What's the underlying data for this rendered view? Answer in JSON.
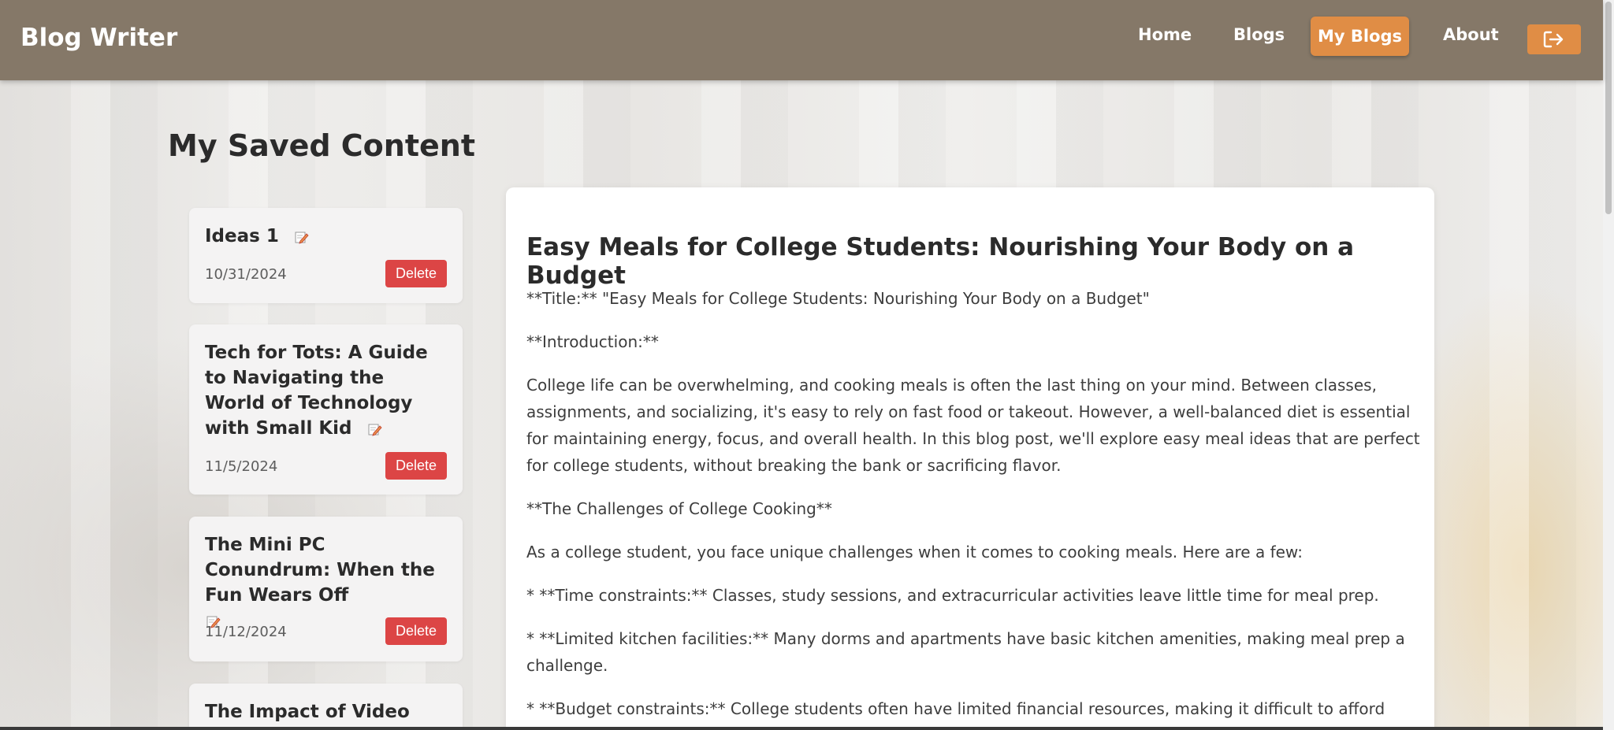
{
  "navbar": {
    "brand": "Blog Writer",
    "links": [
      "Home",
      "Blogs",
      "My Blogs",
      "About"
    ],
    "active_link": "My Blogs",
    "logout_icon": "logout-icon"
  },
  "page": {
    "title": "My Saved Content"
  },
  "saved_items": [
    {
      "title": "Ideas 1",
      "date": "10/31/2024",
      "delete_label": "Delete"
    },
    {
      "title": "Tech for Tots: A Guide to Navigating the World of Technology with Small Kid",
      "date": "11/5/2024",
      "delete_label": "Delete"
    },
    {
      "title": "The Mini PC Conundrum: When the Fun Wears Off",
      "date": "11/12/2024",
      "delete_label": "Delete"
    },
    {
      "title": "The Impact of Video",
      "date": "",
      "delete_label": ""
    }
  ],
  "post": {
    "title": "Easy Meals for College Students: Nourishing Your Body on a Budget",
    "paragraphs": [
      "**Title:** \"Easy Meals for College Students: Nourishing Your Body on a Budget\"",
      "**Introduction:**",
      "College life can be overwhelming, and cooking meals is often the last thing on your mind. Between classes, assignments, and socializing, it's easy to rely on fast food or takeout. However, a well-balanced diet is essential for maintaining energy, focus, and overall health. In this blog post, we'll explore easy meal ideas that are perfect for college students, without breaking the bank or sacrificing flavor.",
      "**The Challenges of College Cooking**",
      "As a college student, you face unique challenges when it comes to cooking meals. Here are a few:",
      "* **Time constraints:** Classes, study sessions, and extracurricular activities leave little time for meal prep.",
      "* **Limited kitchen facilities:** Many dorms and apartments have basic kitchen amenities, making meal prep a challenge.",
      "* **Budget constraints:** College students often have limited financial resources, making it difficult to afford expensive"
    ]
  },
  "colors": {
    "navbar": "#857868",
    "accent": "#e08d45",
    "delete": "#dc4545"
  }
}
